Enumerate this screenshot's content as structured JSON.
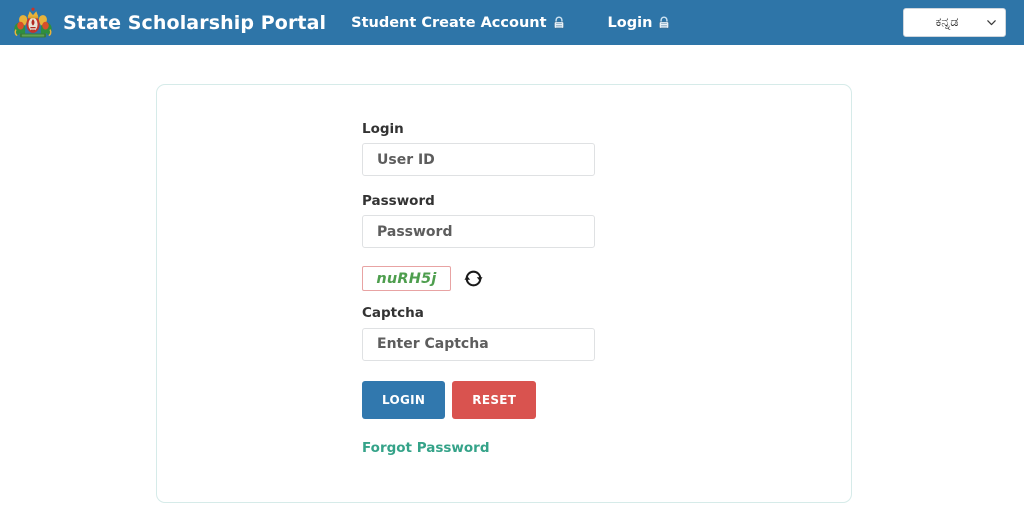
{
  "header": {
    "brand_title": "State Scholarship Portal",
    "emblem_icon": "karnataka-state-emblem",
    "nav": [
      {
        "label": "Student Create Account",
        "icon": "lock-icon"
      },
      {
        "label": "Login",
        "icon": "lock-icon"
      }
    ],
    "language_select": {
      "selected": "ಕನ್ನಡ",
      "chevron_icon": "chevron-down-icon"
    },
    "background_color": "#2e75a8"
  },
  "login_card": {
    "border_color": "#d6ebe9",
    "fields": {
      "login": {
        "label": "Login",
        "placeholder": "User ID",
        "value": ""
      },
      "password": {
        "label": "Password",
        "placeholder": "Password",
        "value": ""
      },
      "captcha": {
        "label": "Captcha",
        "placeholder": "Enter Captcha",
        "value": "",
        "image_text": "nuRH5j",
        "refresh_icon": "refresh-icon",
        "text_color": "#4e9e4e",
        "box_border_color": "#e8a3a3"
      }
    },
    "buttons": {
      "login": {
        "label": "LOGIN",
        "color": "#3178ae"
      },
      "reset": {
        "label": "RESET",
        "color": "#d9534f"
      }
    },
    "forgot_password": {
      "label": "Forgot Password",
      "color": "#35a389"
    }
  }
}
